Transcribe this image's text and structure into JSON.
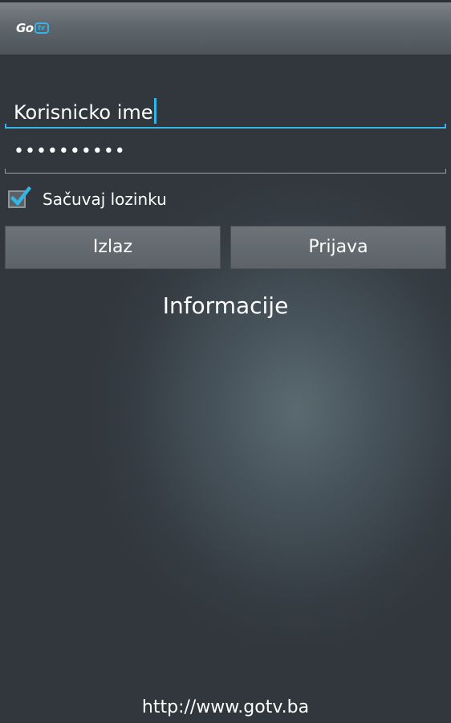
{
  "app": {
    "logo_go": "Go",
    "logo_tv": "tv"
  },
  "login": {
    "username_value": "Korisnicko ime",
    "password_value": "••••••••••",
    "remember_label": "Sačuvaj lozinku",
    "remember_checked": true,
    "exit_label": "Izlaz",
    "login_label": "Prijava",
    "info_label": "Informacije"
  },
  "footer": {
    "url": "http://www.gotv.ba"
  },
  "colors": {
    "accent": "#33b5e5",
    "background": "#353c43",
    "action_bar": "#5f676d"
  }
}
